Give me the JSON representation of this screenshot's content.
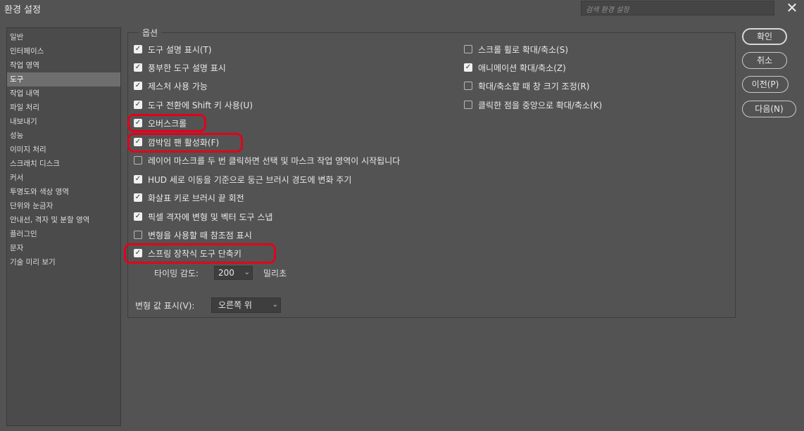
{
  "window": {
    "title": "환경 설정",
    "search_placeholder": "검색 환경 설정",
    "close_glyph": "✕"
  },
  "sidebar": {
    "items": [
      {
        "label": "일반",
        "selected": false
      },
      {
        "label": "인터페이스",
        "selected": false
      },
      {
        "label": "작업 영역",
        "selected": false
      },
      {
        "label": "도구",
        "selected": true
      },
      {
        "label": "작업 내역",
        "selected": false
      },
      {
        "label": "파일 처리",
        "selected": false
      },
      {
        "label": "내보내기",
        "selected": false
      },
      {
        "label": "성능",
        "selected": false
      },
      {
        "label": "이미지 처리",
        "selected": false
      },
      {
        "label": "스크래치 디스크",
        "selected": false
      },
      {
        "label": "커서",
        "selected": false
      },
      {
        "label": "투명도와 색상 영역",
        "selected": false
      },
      {
        "label": "단위와 눈금자",
        "selected": false
      },
      {
        "label": "안내선, 격자 및 분할 영역",
        "selected": false
      },
      {
        "label": "플러그인",
        "selected": false
      },
      {
        "label": "문자",
        "selected": false
      },
      {
        "label": "기술 미리 보기",
        "selected": false
      }
    ]
  },
  "options": {
    "legend": "옵션",
    "left": [
      {
        "label": "도구 설명 표시(T)",
        "checked": true
      },
      {
        "label": "풍부한 도구 설명 표시",
        "checked": true
      },
      {
        "label": "제스처 사용 가능",
        "checked": true
      },
      {
        "label": "도구 전환에 Shift 키 사용(U)",
        "checked": true
      },
      {
        "label": "오버스크롤",
        "checked": true
      },
      {
        "label": "깜박임 팬 활성화(F)",
        "checked": true
      },
      {
        "label": "레이어 마스크를 두 번 클릭하면 선택 및 마스크 작업 영역이 시작됩니다",
        "checked": false
      },
      {
        "label": "HUD 세로 이동을 기준으로 둥근 브러시 경도에 변화 주기",
        "checked": true
      },
      {
        "label": "화살표 키로 브러시 끝 회전",
        "checked": true
      },
      {
        "label": "픽셀 격자에 변형 및 벡터 도구 스냅",
        "checked": true
      },
      {
        "label": "변형을 사용할 때 참조점 표시",
        "checked": false
      },
      {
        "label": "스프링 장착식 도구 단축키",
        "checked": true
      }
    ],
    "right": [
      {
        "label": "스크롤 휠로 확대/축소(S)",
        "checked": false
      },
      {
        "label": "애니메이션 확대/축소(Z)",
        "checked": true
      },
      {
        "label": "확대/축소할 때 창 크기 조정(R)",
        "checked": false
      },
      {
        "label": "클릭한 점을 중앙으로 확대/축소(K)",
        "checked": false
      }
    ],
    "timing": {
      "label": "타이밍 감도:",
      "value": "200",
      "unit": "밀리초"
    },
    "transform": {
      "label": "변형 값 표시(V):",
      "value": "오른쪽 위"
    }
  },
  "buttons": {
    "ok": "확인",
    "cancel": "취소",
    "prev": "이전(P)",
    "next": "다음(N)"
  },
  "colors": {
    "background": "#535353",
    "highlight": "#e3001b"
  }
}
